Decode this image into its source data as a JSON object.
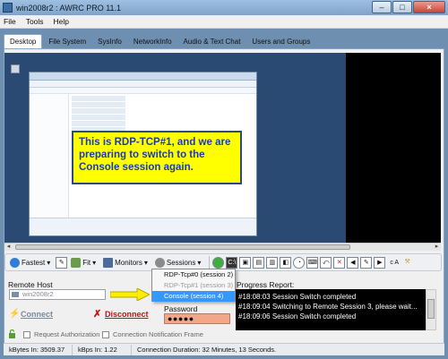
{
  "window": {
    "title": "win2008r2 : AWRC PRO 11.1"
  },
  "menu": {
    "items": [
      "File",
      "Tools",
      "Help"
    ]
  },
  "tabs": [
    "Desktop",
    "File System",
    "SysInfo",
    "NetworkInfo",
    "Audio & Text Chat",
    "Users and Groups"
  ],
  "remote_screen": {
    "callout": "This is RDP-TCP#1, and we are preparing to switch to the Console session again."
  },
  "toolbar": {
    "fastest": "Fastest",
    "fit": "Fit",
    "monitors": "Monitors",
    "sessions": "Sessions",
    "extra_label": "c A"
  },
  "sessions_menu": {
    "items": [
      "RDP-Tcp#0 (session 2)",
      "RDP-Tcp#1 (session 3)",
      "Console (session 4)"
    ],
    "selected": "Console (session 4)"
  },
  "remote_host": {
    "label": "Remote Host",
    "value": "win2008r2"
  },
  "actions": {
    "connect": "Connect",
    "disconnect": "Disconnect"
  },
  "password": {
    "label": "Password",
    "value": "●●●●●"
  },
  "progress": {
    "label": "Progress Report:",
    "lines": [
      "#18:08:03 Session Switch completed",
      "#18:09:04 Switching to Remote Session 3, please wait...",
      "#18:09:06 Session Switch completed"
    ]
  },
  "options": {
    "request_authorization": "Request Authorization",
    "connection_notification": "Connection Notification Frame"
  },
  "status": {
    "kbytes_in": "kBytes In: 3509.37",
    "kbps_in": "kBps In: 1.22",
    "duration": "Connection Duration: 32 Minutes, 13 Seconds."
  },
  "colors": {
    "callout_bg": "#ffff00",
    "callout_text": "#1a3bb0",
    "selected": "#3399ff",
    "password_bg": "#f2a789"
  }
}
